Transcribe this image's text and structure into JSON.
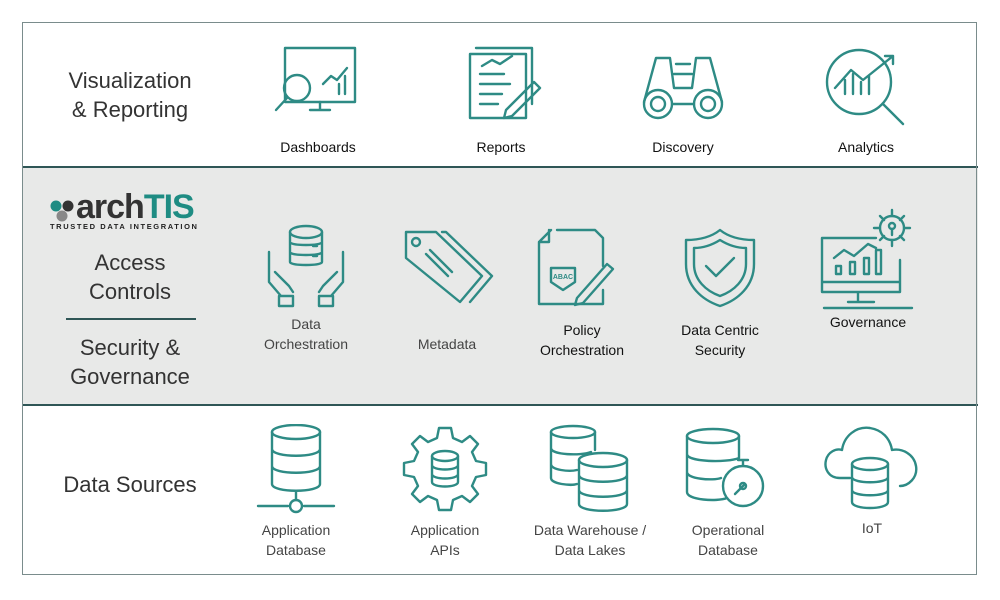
{
  "colors": {
    "accent": "#2e8b85",
    "divider": "#2f5656",
    "middle_band": "#e8e9e8"
  },
  "logo": {
    "brand_prefix": "arch",
    "brand_suffix": "TIS",
    "tagline": "TRUSTED DATA INTEGRATION"
  },
  "visualization": {
    "title_line1": "Visualization",
    "title_line2": "& Reporting",
    "items": [
      {
        "label": "Dashboards",
        "icon": "dashboard-magnifier-icon"
      },
      {
        "label": "Reports",
        "icon": "report-pencil-icon"
      },
      {
        "label": "Discovery",
        "icon": "binoculars-icon"
      },
      {
        "label": "Analytics",
        "icon": "chart-magnifier-icon"
      }
    ]
  },
  "security": {
    "title1_line1": "Access",
    "title1_line2": "Controls",
    "title2_line1": "Security &",
    "title2_line2": "Governance",
    "items": [
      {
        "label_line1": "Data",
        "label_line2": "Orchestration",
        "icon": "hands-database-icon"
      },
      {
        "label_line1": "Metadata",
        "label_line2": "",
        "icon": "tags-icon"
      },
      {
        "label_line1": "Policy",
        "label_line2": "Orchestration",
        "icon": "abac-document-icon",
        "badge": "ABAC"
      },
      {
        "label_line1": "Data Centric",
        "label_line2": "Security",
        "icon": "shield-check-icon"
      },
      {
        "label_line1": "Governance",
        "label_line2": "",
        "icon": "monitor-gear-lock-icon"
      }
    ]
  },
  "sources": {
    "title": "Data Sources",
    "items": [
      {
        "label_line1": "Application",
        "label_line2": "Database",
        "icon": "database-network-icon"
      },
      {
        "label_line1": "Application",
        "label_line2": "APIs",
        "icon": "gear-database-icon"
      },
      {
        "label_line1": "Data Warehouse /",
        "label_line2": "Data Lakes",
        "icon": "databases-icon"
      },
      {
        "label_line1": "Operational",
        "label_line2": "Database",
        "icon": "database-gauge-icon"
      },
      {
        "label_line1": "IoT",
        "label_line2": "",
        "icon": "cloud-database-icon"
      }
    ]
  }
}
